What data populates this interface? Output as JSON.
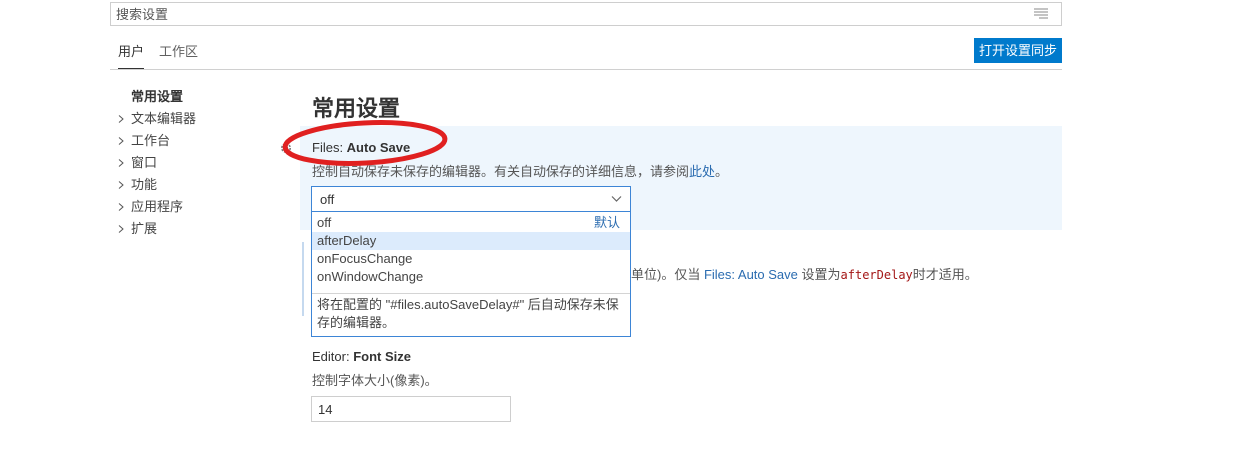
{
  "search": {
    "placeholder": "搜索设置"
  },
  "tabs": [
    {
      "label": "用户",
      "active": true
    },
    {
      "label": "工作区",
      "active": false
    }
  ],
  "sync_button_label": "打开设置同步",
  "toc": [
    {
      "label": "常用设置",
      "active": true,
      "expandable": false
    },
    {
      "label": "文本编辑器",
      "active": false,
      "expandable": true
    },
    {
      "label": "工作台",
      "active": false,
      "expandable": true
    },
    {
      "label": "窗口",
      "active": false,
      "expandable": true
    },
    {
      "label": "功能",
      "active": false,
      "expandable": true
    },
    {
      "label": "应用程序",
      "active": false,
      "expandable": true
    },
    {
      "label": "扩展",
      "active": false,
      "expandable": true
    }
  ],
  "section_title": "常用设置",
  "auto_save": {
    "category": "Files: ",
    "name": "Auto Save",
    "description": "控制自动保存未保存的编辑器。有关自动保存的详细信息，请参阅",
    "link": "此处",
    "description_end": "。",
    "value": "off",
    "options": [
      {
        "label": "off",
        "tag": "默认",
        "hovered": false
      },
      {
        "label": "afterDelay",
        "tag": "",
        "hovered": true
      },
      {
        "label": "onFocusChange",
        "tag": "",
        "hovered": false
      },
      {
        "label": "onWindowChange",
        "tag": "",
        "hovered": false
      }
    ],
    "option_description": "将在配置的 \"#files.autoSaveDelay#\" 后自动保存未保存的编辑器。"
  },
  "auto_save_delay": {
    "desc_visible_a": "单位)。仅当 ",
    "desc_link": "Files: Auto Save",
    "desc_visible_b": " 设置为",
    "desc_code": "afterDelay",
    "desc_visible_c": "时才适用。"
  },
  "font_size": {
    "category": "Editor: ",
    "name": "Font Size",
    "description": "控制字体大小(像素)。",
    "value": "14"
  },
  "colors": {
    "accent": "#007acc",
    "highlight_bg": "#eef6fd",
    "annotation_red": "#e02020",
    "link": "#2b6cb0"
  }
}
